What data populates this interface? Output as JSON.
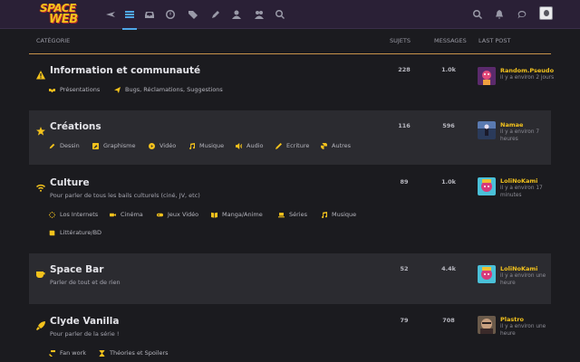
{
  "logo": {
    "line1": "SPACE",
    "line2": "WEB"
  },
  "nav": [
    "plane-icon",
    "list-icon",
    "inbox-icon",
    "clock-icon",
    "tags-icon",
    "pen-icon",
    "user-icon",
    "users-icon",
    "search-icon"
  ],
  "header_right": [
    "search-icon",
    "bell-icon",
    "chat-icon"
  ],
  "columns": {
    "category": "CATÉGORIE",
    "topics": "SUJETS",
    "messages": "MESSAGES",
    "last_post": "LAST POST"
  },
  "colors": {
    "accent": "#f3c21c",
    "topbar": "#2a2036",
    "active_nav": "#4fa6e8",
    "divider": "#c8924a",
    "background": "#1b1b1f"
  },
  "categories": [
    {
      "icon": "warning-icon",
      "title": "Information et communauté",
      "description": "",
      "topics": "228",
      "messages": "1.0k",
      "subs": [
        {
          "icon": "handshake-icon",
          "label": "Présentations"
        },
        {
          "icon": "paper-plane-icon",
          "label": "Bugs, Réclamations, Suggestions"
        }
      ],
      "last": {
        "user": "Random.Pseudo",
        "time": "il y a environ 2 jours"
      }
    },
    {
      "icon": "star-icon",
      "title": "Créations",
      "description": "",
      "topics": "116",
      "messages": "596",
      "subs": [
        {
          "icon": "pencil-icon",
          "label": "Dessin"
        },
        {
          "icon": "graphic-icon",
          "label": "Graphisme"
        },
        {
          "icon": "video-icon",
          "label": "Vidéo"
        },
        {
          "icon": "music-icon",
          "label": "Musique"
        },
        {
          "icon": "audio-icon",
          "label": "Audio"
        },
        {
          "icon": "writing-icon",
          "label": "Ecriture"
        },
        {
          "icon": "film-icon",
          "label": "Autres"
        }
      ],
      "last": {
        "user": "Namae",
        "time": "il y a environ 7 heures"
      }
    },
    {
      "icon": "wifi-icon",
      "title": "Culture",
      "description": "Pour parler de tous les bails culturels (ciné, JV, etc)",
      "topics": "89",
      "messages": "1.0k",
      "subs": [
        {
          "icon": "spinner-icon",
          "label": "Los Internets"
        },
        {
          "icon": "camera-icon",
          "label": "Cinéma"
        },
        {
          "icon": "gamepad-icon",
          "label": "Jeux Vidéo"
        },
        {
          "icon": "book-open-icon",
          "label": "Manga/Anime"
        },
        {
          "icon": "laptop-icon",
          "label": "Séries"
        },
        {
          "icon": "music-icon",
          "label": "Musique"
        },
        {
          "icon": "book-icon",
          "label": "Littérature/BD"
        }
      ],
      "last": {
        "user": "LoliNoKami",
        "time": "il y a environ 17 minutes"
      }
    },
    {
      "icon": "coffee-icon",
      "title": "Space Bar",
      "description": "Parler de tout et de rien",
      "topics": "52",
      "messages": "4.4k",
      "subs": [],
      "last": {
        "user": "LoliNoKami",
        "time": "il y a environ une heure"
      }
    },
    {
      "icon": "rocket-icon",
      "title": "Clyde Vanilla",
      "description": "Pour parler de la série !",
      "topics": "79",
      "messages": "708",
      "subs": [
        {
          "icon": "hammer-icon",
          "label": "Fan work"
        },
        {
          "icon": "hourglass-icon",
          "label": "Théories et Spoilers"
        }
      ],
      "last": {
        "user": "Plastro",
        "time": "il y a environ une heure"
      }
    }
  ]
}
